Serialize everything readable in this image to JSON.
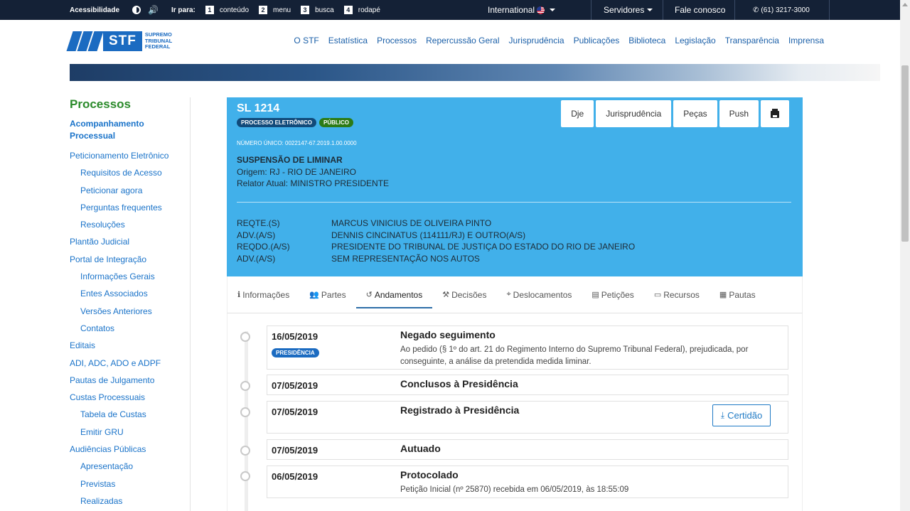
{
  "topbar": {
    "acessibilidade": "Acessibilidade",
    "ir_para": "Ir para:",
    "shortcuts": [
      {
        "key": "1",
        "label": "conteúdo"
      },
      {
        "key": "2",
        "label": "menu"
      },
      {
        "key": "3",
        "label": "busca"
      },
      {
        "key": "4",
        "label": "rodapé"
      }
    ],
    "international": "International",
    "servidores": "Servidores",
    "fale_conosco": "Fale conosco",
    "phone": "(61) 3217-3000"
  },
  "logo": {
    "abbr": "STF",
    "line1": "SUPREMO",
    "line2": "TRIBUNAL",
    "line3": "FEDERAL"
  },
  "nav": [
    "O STF",
    "Estatística",
    "Processos",
    "Repercussão Geral",
    "Jurisprudência",
    "Publicações",
    "Biblioteca",
    "Legislação",
    "Transparência",
    "Imprensa"
  ],
  "sidebar": {
    "title": "Processos",
    "items": [
      {
        "label": "Acompanhamento Processual",
        "level": 0,
        "active": true
      },
      {
        "label": "Peticionamento Eletrônico",
        "level": 0
      },
      {
        "label": "Requisitos de Acesso",
        "level": 1
      },
      {
        "label": "Peticionar agora",
        "level": 1
      },
      {
        "label": "Perguntas frequentes",
        "level": 1
      },
      {
        "label": "Resoluções",
        "level": 1
      },
      {
        "label": "Plantão Judicial",
        "level": 0
      },
      {
        "label": "Portal de Integração",
        "level": 0
      },
      {
        "label": "Informações Gerais",
        "level": 1
      },
      {
        "label": "Entes Associados",
        "level": 1
      },
      {
        "label": "Versões Anteriores",
        "level": 1
      },
      {
        "label": "Contatos",
        "level": 1
      },
      {
        "label": "Editais",
        "level": 0
      },
      {
        "label": "ADI, ADC, ADO e ADPF",
        "level": 0
      },
      {
        "label": "Pautas de Julgamento",
        "level": 0
      },
      {
        "label": "Custas Processuais",
        "level": 0
      },
      {
        "label": "Tabela de Custas",
        "level": 1
      },
      {
        "label": "Emitir GRU",
        "level": 1
      },
      {
        "label": "Audiências Públicas",
        "level": 0
      },
      {
        "label": "Apresentação",
        "level": 1
      },
      {
        "label": "Previstas",
        "level": 1
      },
      {
        "label": "Realizadas",
        "level": 1
      }
    ]
  },
  "process": {
    "id": "SL 1214",
    "badge_eletronico": "PROCESSO ELETRÔNICO",
    "badge_publico": "PÚBLICO",
    "numero_unico": "NÚMERO ÚNICO: 0022147-67.2019.1.00.0000",
    "classe": "SUSPENSÃO DE LIMINAR",
    "origem": "Origem: RJ - RIO DE JANEIRO",
    "relator": "Relator Atual: MINISTRO PRESIDENTE",
    "buttons": {
      "dje": "Dje",
      "jurisprudencia": "Jurisprudência",
      "pecas": "Peças",
      "push": "Push"
    },
    "parties": [
      {
        "role": "REQTE.(S)",
        "name": "MARCUS VINICIUS DE OLIVEIRA PINTO"
      },
      {
        "role": "ADV.(A/S)",
        "name": "DENNIS CINCINATUS (114111/RJ) E OUTRO(A/S)"
      },
      {
        "role": "REQDO.(A/S)",
        "name": "PRESIDENTE DO TRIBUNAL DE JUSTIÇA DO ESTADO DO RIO DE JANEIRO"
      },
      {
        "role": "ADV.(A/S)",
        "name": "SEM REPRESENTAÇÃO NOS AUTOS"
      }
    ]
  },
  "tabs": [
    {
      "label": "Informações",
      "icon": "info-circle-icon",
      "glyph": "ℹ"
    },
    {
      "label": "Partes",
      "icon": "users-icon",
      "glyph": "👥"
    },
    {
      "label": "Andamentos",
      "icon": "history-icon",
      "glyph": "↺",
      "active": true
    },
    {
      "label": "Decisões",
      "icon": "gavel-icon",
      "glyph": "⚒"
    },
    {
      "label": "Deslocamentos",
      "icon": "map-marker-icon",
      "glyph": "⌖"
    },
    {
      "label": "Petições",
      "icon": "file-pdf-icon",
      "glyph": "▤"
    },
    {
      "label": "Recursos",
      "icon": "file-text-icon",
      "glyph": "▭"
    },
    {
      "label": "Pautas",
      "icon": "calendar-icon",
      "glyph": "▦"
    }
  ],
  "andamentos": [
    {
      "date": "16/05/2019",
      "badge": "PRESIDÊNCIA",
      "title": "Negado seguimento",
      "desc": "Ao pedido (§ 1º do art. 21 do Regimento Interno do Supremo Tribunal Federal), prejudicada, por conseguinte, a análise da pretendida medida liminar."
    },
    {
      "date": "07/05/2019",
      "title": "Conclusos à Presidência"
    },
    {
      "date": "07/05/2019",
      "title": "Registrado à Presidência",
      "action": "Certidão"
    },
    {
      "date": "07/05/2019",
      "title": "Autuado"
    },
    {
      "date": "06/05/2019",
      "title": "Protocolado",
      "desc": "Petição Inicial (nº 25870) recebida em 06/05/2019, às 18:55:09"
    }
  ]
}
